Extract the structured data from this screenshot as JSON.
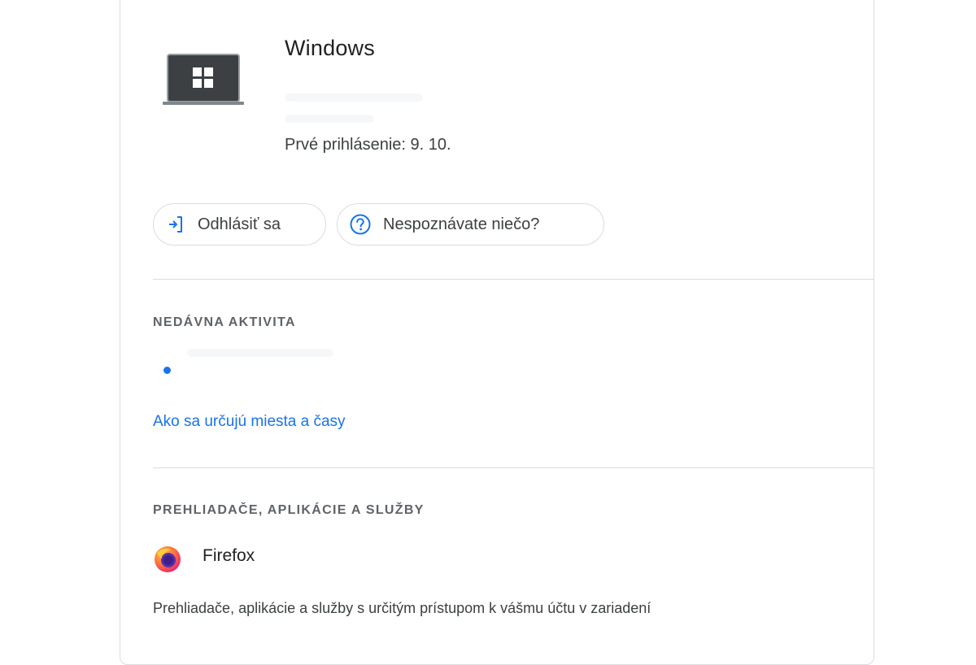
{
  "device": {
    "name": "Windows",
    "icon": "windows-laptop-icon",
    "first_signin": "Prvé prihlásenie: 9. 10."
  },
  "actions": {
    "signout": {
      "label": "Odhlásiť sa",
      "icon": "sign-out-icon"
    },
    "unrecognized": {
      "label": "Nespoznávate niečo?",
      "icon": "help-circle-icon"
    }
  },
  "recent_activity": {
    "heading": "NEDÁVNA AKTIVITA",
    "link": "Ako sa určujú miesta a časy"
  },
  "apps": {
    "heading": "PREHLIADAČE, APLIKÁCIE A SLUŽBY",
    "items": [
      {
        "name": "Firefox",
        "icon": "firefox-icon"
      }
    ],
    "description": "Prehliadače, aplikácie a služby s určitým prístupom k vášmu účtu v zariadení"
  },
  "colors": {
    "accent": "#1a73e8",
    "text": "#202124",
    "secondary_text": "#5f6368",
    "border": "#dadce0"
  }
}
